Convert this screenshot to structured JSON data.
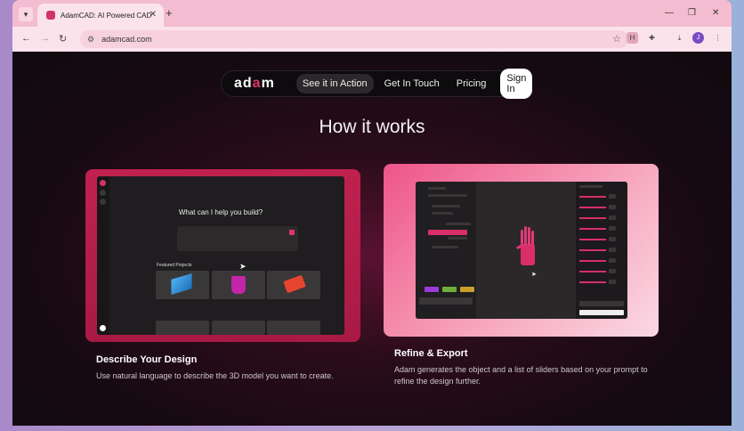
{
  "browser": {
    "tab_title": "AdamCAD: AI Powered CAD",
    "url": "adamcad.com",
    "profile_initial": "J",
    "extension_label": "H"
  },
  "nav": {
    "logo_text": "adam",
    "items": [
      "See it in Action",
      "Get In Touch",
      "Pricing"
    ],
    "sign_in": "Sign In"
  },
  "section_title": "How it works",
  "steps": [
    {
      "title": "Describe Your Design",
      "description": "Use natural language to describe the 3D model you want to create."
    },
    {
      "title": "Refine & Export",
      "description": "Adam generates the object and a list of sliders based on your prompt to refine the design further."
    }
  ],
  "mockup_left": {
    "question": "What can I help you build?",
    "featured_label": "Featured Projects"
  },
  "colors": {
    "accent": "#e0336e",
    "card_left": "#b81c49",
    "card_right": "#f07aa0"
  }
}
